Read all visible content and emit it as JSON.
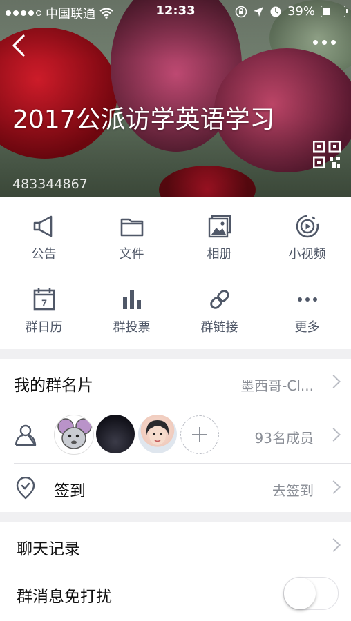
{
  "status_bar": {
    "carrier": "中国联通",
    "time": "12:33",
    "battery_percent": "39%",
    "battery_level": 0.39,
    "icons": [
      "signal-dots-icon",
      "wifi-icon",
      "orientation-lock-icon",
      "location-arrow-icon",
      "alarm-icon",
      "battery-icon"
    ]
  },
  "header": {
    "group_name": "2017公派访学英语学习",
    "group_id": "483344867",
    "back_icon": "chevron-left-icon",
    "more_icon": "more-dots-icon",
    "qr_icon": "qr-code-icon"
  },
  "shortcuts": [
    {
      "label": "公告",
      "icon": "megaphone-icon"
    },
    {
      "label": "文件",
      "icon": "folder-icon"
    },
    {
      "label": "相册",
      "icon": "album-icon"
    },
    {
      "label": "小视频",
      "icon": "video-icon"
    },
    {
      "label": "群日历",
      "icon": "calendar-icon",
      "calendar_day": "7"
    },
    {
      "label": "群投票",
      "icon": "bar-chart-icon"
    },
    {
      "label": "群链接",
      "icon": "link-icon"
    },
    {
      "label": "更多",
      "icon": "more-dots-icon"
    }
  ],
  "my_card": {
    "label": "我的群名片",
    "value": "墨西哥-Cl..."
  },
  "members": {
    "count_label": "93名成员",
    "icon": "members-icon"
  },
  "checkin": {
    "label": "签到",
    "action": "去签到",
    "icon": "location-pin-icon"
  },
  "chat_history": {
    "label": "聊天记录"
  },
  "mute": {
    "label": "群消息免打扰",
    "enabled": false
  },
  "colors": {
    "icon_gray": "#505868",
    "chevron": "#b9bcc4",
    "value_gray": "#8a8e96",
    "background": "#f0f0f2"
  }
}
